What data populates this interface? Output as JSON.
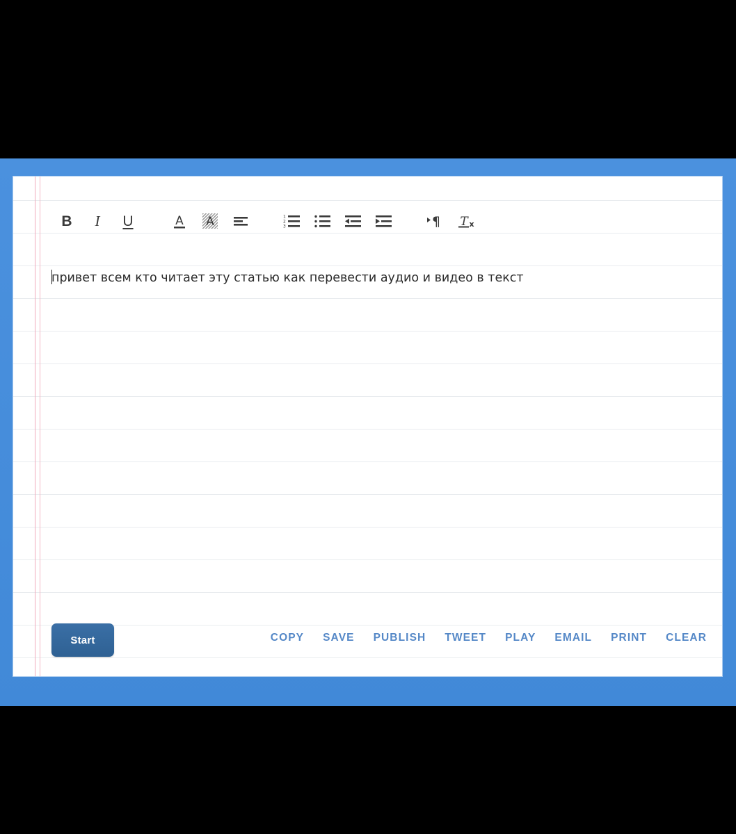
{
  "theme": {
    "frame_color": "#4a90dd",
    "paper_color": "#ffffff",
    "rule_color": "#e9ecef",
    "margin_line_color": "#f0a9bb",
    "start_button_color": "#36699e",
    "action_link_color": "#5588c7",
    "text_color": "#2b2b2b"
  },
  "toolbar": {
    "buttons": [
      {
        "name": "bold-icon",
        "label": "B",
        "title": "Bold"
      },
      {
        "name": "italic-icon",
        "label": "I",
        "title": "Italic"
      },
      {
        "name": "underline-icon",
        "label": "U",
        "title": "Underline"
      },
      {
        "name": "text-color-icon",
        "label": "A",
        "title": "Text Color"
      },
      {
        "name": "highlight-color-icon",
        "label": "A",
        "title": "Highlight Color"
      },
      {
        "name": "align-icon",
        "label": "",
        "title": "Align"
      },
      {
        "name": "numbered-list-icon",
        "label": "",
        "title": "Numbered List"
      },
      {
        "name": "bullet-list-icon",
        "label": "",
        "title": "Bullet List"
      },
      {
        "name": "outdent-icon",
        "label": "",
        "title": "Decrease Indent"
      },
      {
        "name": "indent-icon",
        "label": "",
        "title": "Increase Indent"
      },
      {
        "name": "text-direction-icon",
        "label": "¶",
        "title": "Text Direction"
      },
      {
        "name": "remove-format-icon",
        "label": "Tx",
        "title": "Remove Formatting"
      }
    ]
  },
  "editor": {
    "content": "привет всем кто читает эту статью как перевести аудио и видео в текст",
    "placeholder": "",
    "caret_visible": true
  },
  "actions": {
    "start_label": "Start",
    "links": [
      {
        "label": "COPY"
      },
      {
        "label": "SAVE"
      },
      {
        "label": "PUBLISH"
      },
      {
        "label": "TWEET"
      },
      {
        "label": "PLAY"
      },
      {
        "label": "EMAIL"
      },
      {
        "label": "PRINT"
      },
      {
        "label": "CLEAR"
      }
    ]
  }
}
